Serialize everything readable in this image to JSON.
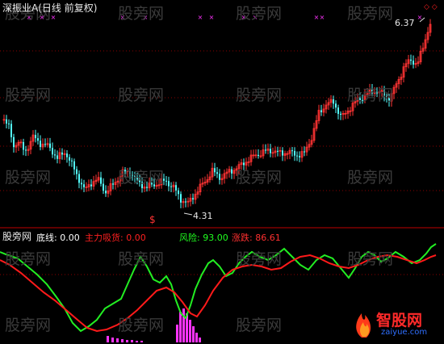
{
  "top_panel": {
    "title": "深振业A(日线 前复权)",
    "price_high_label": "6.37",
    "price_low_label": "4.31",
    "dollar_marker": "$",
    "corner_glyphs": "◇ ◇"
  },
  "bottom_panel": {
    "name": "股旁网",
    "indicator_1": {
      "label": "底线:",
      "value": "0.00",
      "color": "#ffffff"
    },
    "indicator_2": {
      "label": "主力吸货:",
      "value": "0.00",
      "color": "#ff2020"
    },
    "indicator_3": {
      "label": "风险:",
      "value": "93.00",
      "color": "#20ff20"
    },
    "indicator_4": {
      "label": "涨跌:",
      "value": "86.61",
      "color": "#ff3030"
    }
  },
  "watermark": "股旁网",
  "logo": {
    "main": "智股网",
    "sub": "zaiyue.com"
  },
  "colors": {
    "up": "#ff3333",
    "down": "#54ffff",
    "green": "#22ee22",
    "red": "#ff1a1a",
    "magenta": "#ff33ff",
    "grid": "#8a0000"
  }
}
